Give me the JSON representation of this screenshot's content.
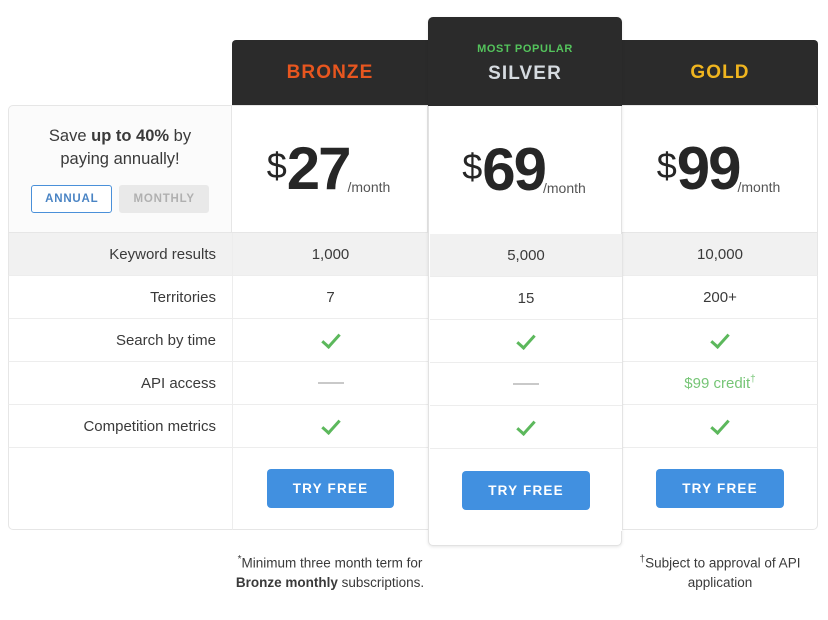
{
  "promo": {
    "text_before": "Save ",
    "text_bold": "up to 40%",
    "text_after": " by paying annually!",
    "toggle_annual": "ANNUAL",
    "toggle_monthly": "MONTHLY"
  },
  "colors": {
    "bronze": "#e8561f",
    "silver": "#d6dbe0",
    "gold": "#f0b51f",
    "most_popular": "#54c45c",
    "header_bg": "#2b2b2b",
    "cta_blue": "#4190e0",
    "check_green": "#5cb85c",
    "credit_green": "#76c576",
    "toggle_active": "#4a84c4"
  },
  "plans": [
    {
      "name": "BRONZE",
      "badge": "",
      "currency": "$",
      "amount": "27",
      "period": "/month",
      "footnote_mark": "*",
      "cta": "TRY FREE"
    },
    {
      "name": "SILVER",
      "badge": "MOST POPULAR",
      "currency": "$",
      "amount": "69",
      "period": "/month",
      "footnote_mark": "",
      "cta": "TRY FREE"
    },
    {
      "name": "GOLD",
      "badge": "",
      "currency": "$",
      "amount": "99",
      "period": "/month",
      "footnote_mark": "",
      "cta": "TRY FREE"
    }
  ],
  "features": [
    {
      "label": "Keyword results",
      "shaded": true,
      "values": [
        {
          "type": "text",
          "text": "1,000"
        },
        {
          "type": "text",
          "text": "5,000"
        },
        {
          "type": "text",
          "text": "10,000"
        }
      ]
    },
    {
      "label": "Territories",
      "shaded": false,
      "values": [
        {
          "type": "text",
          "text": "7"
        },
        {
          "type": "text",
          "text": "15"
        },
        {
          "type": "text",
          "text": "200+"
        }
      ]
    },
    {
      "label": "Search by time",
      "shaded": false,
      "values": [
        {
          "type": "check",
          "text": ""
        },
        {
          "type": "check",
          "text": ""
        },
        {
          "type": "check",
          "text": ""
        }
      ]
    },
    {
      "label": "API access",
      "shaded": false,
      "values": [
        {
          "type": "dash",
          "text": ""
        },
        {
          "type": "dash",
          "text": ""
        },
        {
          "type": "credit",
          "text": "$99 credit",
          "mark": "†"
        }
      ]
    },
    {
      "label": "Competition metrics",
      "shaded": false,
      "values": [
        {
          "type": "check",
          "text": ""
        },
        {
          "type": "check",
          "text": ""
        },
        {
          "type": "check",
          "text": ""
        }
      ]
    }
  ],
  "footnotes": {
    "left_mark": "*",
    "left_before": "Minimum three month term for ",
    "left_bold": "Bronze monthly",
    "left_after": " subscriptions.",
    "right_mark": "†",
    "right_text": "Subject to approval of API application"
  }
}
